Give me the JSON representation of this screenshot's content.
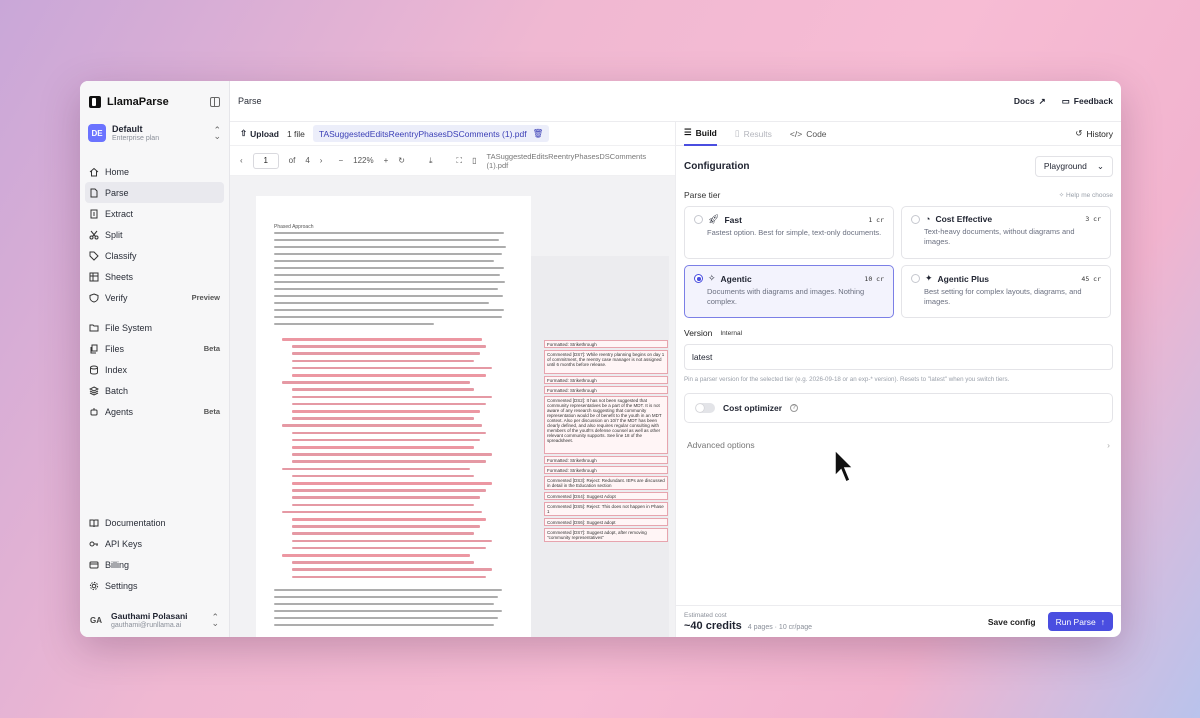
{
  "app": {
    "brand": "LlamaParse",
    "breadcrumb": "Parse"
  },
  "org": {
    "initials": "DE",
    "name": "Default",
    "plan": "Enterprise plan"
  },
  "nav_primary": [
    {
      "label": "Home",
      "icon": "home-icon"
    },
    {
      "label": "Parse",
      "icon": "file-icon",
      "active": true
    },
    {
      "label": "Extract",
      "icon": "extract-icon"
    },
    {
      "label": "Split",
      "icon": "scissors-icon"
    },
    {
      "label": "Classify",
      "icon": "tag-icon"
    },
    {
      "label": "Sheets",
      "icon": "sheet-icon"
    },
    {
      "label": "Verify",
      "icon": "shield-icon",
      "badge": "Preview"
    }
  ],
  "nav_secondary": [
    {
      "label": "File System",
      "icon": "folder-icon"
    },
    {
      "label": "Files",
      "icon": "files-icon",
      "badge": "Beta"
    },
    {
      "label": "Index",
      "icon": "index-icon"
    },
    {
      "label": "Batch",
      "icon": "batch-icon"
    },
    {
      "label": "Agents",
      "icon": "agent-icon",
      "badge": "Beta"
    }
  ],
  "nav_bottom": [
    {
      "label": "Documentation",
      "icon": "book-icon"
    },
    {
      "label": "API Keys",
      "icon": "key-icon"
    },
    {
      "label": "Billing",
      "icon": "card-icon"
    },
    {
      "label": "Settings",
      "icon": "gear-icon"
    }
  ],
  "user": {
    "initials": "GA",
    "name": "Gauthami Polasani",
    "email": "gauthami@runllama.ai"
  },
  "topbar": {
    "docs": "Docs",
    "feedback": "Feedback"
  },
  "filebar": {
    "upload": "Upload",
    "count": "1 file",
    "filename": "TASuggestedEditsReentryPhasesDSComments (1).pdf"
  },
  "viewer": {
    "page": "1",
    "of": "of",
    "total": "4",
    "zoom": "122%",
    "filename": "TASuggestedEditsReentryPhasesDSComments (1).pdf"
  },
  "document": {
    "title": "Phased Approach",
    "comments": [
      "Formatted: Strikethrough",
      "Commented [DS7]: While reentry planning begins on day 1 of commitment, the reentry case manager is not assigned until 6 months before release.",
      "Formatted: Strikethrough",
      "Formatted: Strikethrough",
      "Commented [DS2]: It has not been suggested that community representatives be a part of the MDT. It is not aware of any research suggesting that community representation would be of benefit to the youth in an MDT context. Also per discussion on 10/7 the MDT has been clearly defined, and also requires regular consulting with members of the youth's defense counsel as well as other relevant community supports. See line 18 of the spreadsheet.",
      "Formatted: Strikethrough",
      "Formatted: Strikethrough",
      "Commented [DS3]: Reject: Redundant. IEPs are discussed in detail in the Education section",
      "Commented [DS4]: Suggest Adopt",
      "Commented [DS5]: Reject: This does not happen in Phase 1",
      "Commented [DS6]: Suggest adopt",
      "Commented [DS7]: Suggest adopt, after removing \"community representatives\""
    ]
  },
  "tabs": {
    "build": "Build",
    "results": "Results",
    "code": "Code",
    "history": "History"
  },
  "config": {
    "title": "Configuration",
    "mode": "Playground",
    "tier_label": "Parse tier",
    "help": "Help me choose",
    "tiers": [
      {
        "name": "Fast",
        "cost": "1 cr",
        "desc": "Fastest option. Best for simple, text-only documents.",
        "icon": "rocket-icon",
        "selected": false
      },
      {
        "name": "Cost Effective",
        "cost": "3 cr",
        "desc": "Text-heavy documents, without diagrams and images.",
        "icon": "coin-icon",
        "selected": false
      },
      {
        "name": "Agentic",
        "cost": "10 cr",
        "desc": "Documents with diagrams and images. Nothing complex.",
        "icon": "sparkle-icon",
        "selected": true
      },
      {
        "name": "Agentic Plus",
        "cost": "45 cr",
        "desc": "Best setting for complex layouts, diagrams, and images.",
        "icon": "sparkle-plus-icon",
        "selected": false
      }
    ],
    "version_label": "Version",
    "internal": "Internal",
    "version_value": "latest",
    "version_hint": "Pin a parser version for the selected tier (e.g. 2026-09-18 or an exp-* version). Resets to \"latest\" when you switch tiers.",
    "cost_optimizer": "Cost optimizer",
    "advanced": "Advanced options"
  },
  "footer": {
    "est_label": "Estimated cost",
    "credits": "~40 credits",
    "detail": "4 pages · 10 cr/page",
    "save": "Save config",
    "run": "Run Parse"
  },
  "colors": {
    "accent": "#4a4ee0",
    "selected_bg": "#f3f3fd",
    "comment_border": "#e7a4ae"
  }
}
